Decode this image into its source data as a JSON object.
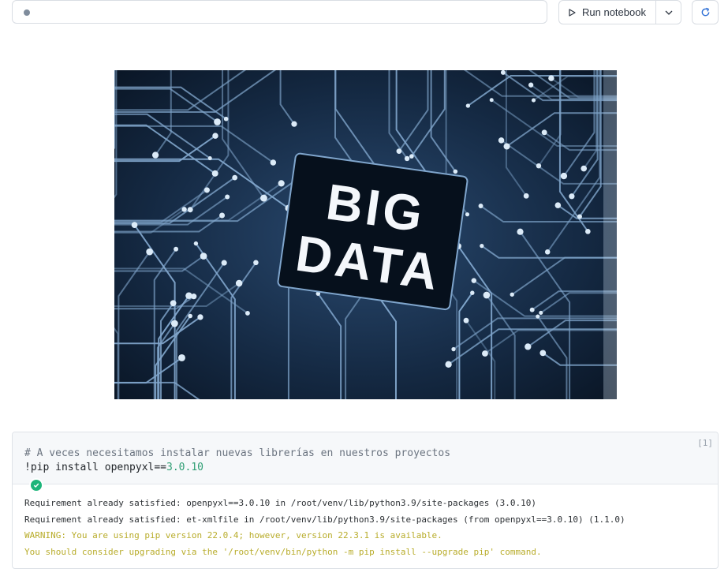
{
  "toolbar": {
    "run_label": "Run notebook",
    "icons": [
      "status-dot",
      "play-icon",
      "chevron-down-icon",
      "refresh-icon"
    ]
  },
  "hero": {
    "title_line1": "BIG",
    "title_line2": "DATA"
  },
  "cell": {
    "exec_count": "[1]",
    "code_comment": "# A veces necesitamos instalar nuevas librerías en nuestros proyectos",
    "code_cmd": "!pip install openpyxl==",
    "code_version": "3.0.10",
    "status": "success",
    "output": [
      {
        "text": "Requirement already satisfied: openpyxl==3.0.10 in /root/venv/lib/python3.9/site-packages (3.0.10)",
        "level": "info"
      },
      {
        "text": "Requirement already satisfied: et-xmlfile in /root/venv/lib/python3.9/site-packages (from openpyxl==3.0.10) (1.1.0)",
        "level": "info"
      },
      {
        "text": "WARNING: You are using pip version 22.0.4; however, version 22.3.1 is available.",
        "level": "warning"
      },
      {
        "text": "You should consider upgrading via the '/root/venv/bin/python -m pip install --upgrade pip' command.",
        "level": "warning"
      }
    ]
  },
  "colors": {
    "success": "#1db57a",
    "warning": "#b8ac2a"
  }
}
